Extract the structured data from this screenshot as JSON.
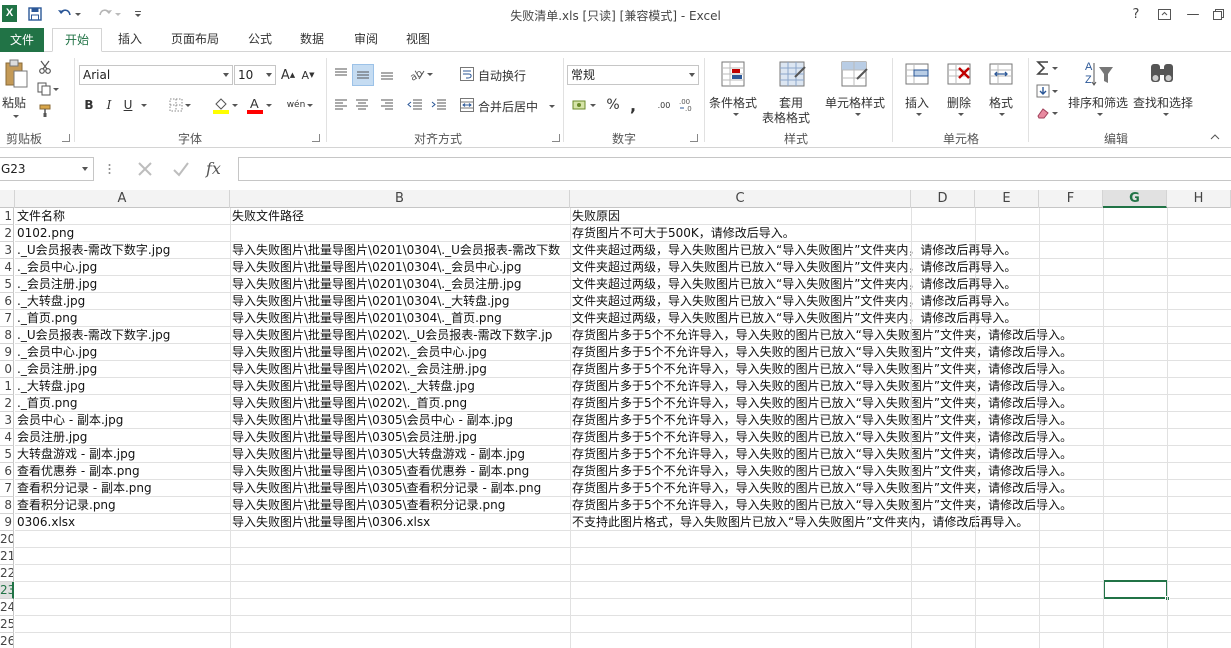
{
  "window": {
    "title": "失败清单.xls  [只读]  [兼容模式] - Excel",
    "help_label": "?",
    "min_label": "—",
    "accent": "#217346"
  },
  "ribbon_tabs": [
    "文件",
    "开始",
    "插入",
    "页面布局",
    "公式",
    "数据",
    "审阅",
    "视图"
  ],
  "ribbon": {
    "clipboard": {
      "paste": "粘贴",
      "label": "剪贴板"
    },
    "font": {
      "name": "Arial",
      "size": "10",
      "bold": "B",
      "italic": "I",
      "underline": "U",
      "pinyin": "wén",
      "label": "字体"
    },
    "alignment": {
      "wrap": "自动换行",
      "merge": "合并后居中",
      "label": "对齐方式"
    },
    "number": {
      "format": "常规",
      "percent": "%",
      "comma": ",",
      "inc_dec": ".00",
      "label": "数字"
    },
    "styles": {
      "cond": "条件格式",
      "table1": "套用",
      "table2": "表格格式",
      "cell": "单元格样式",
      "label": "样式"
    },
    "cells": {
      "insert": "插入",
      "delete": "删除",
      "format": "格式",
      "label": "单元格"
    },
    "editing": {
      "sort": "排序和筛选",
      "find": "查找和选择",
      "label": "编辑"
    }
  },
  "formula_bar": {
    "name_box": "G23",
    "value": ""
  },
  "columns": [
    "A",
    "B",
    "C",
    "D",
    "E",
    "F",
    "G",
    "H"
  ],
  "selected_column": "G",
  "selected_row": "23",
  "row_numbers": [
    "1",
    "2",
    "3",
    "4",
    "5",
    "6",
    "7",
    "8",
    "9",
    "0",
    "1",
    "2",
    "3",
    "4",
    "5",
    "6",
    "7",
    "8",
    "9",
    "20",
    "21",
    "22",
    "23",
    "24",
    "25",
    "26"
  ],
  "rows": [
    [
      "文件名称",
      "失败文件路径",
      "失败原因"
    ],
    [
      "0102.png",
      "",
      "存货图片不可大于500K，请修改后导入。"
    ],
    [
      "._U会员报表-需改下数字.jpg",
      "导入失败图片\\批量导图片\\0201\\0304\\._U会员报表-需改下数",
      "文件夹超过两级，导入失败图片已放入“导入失败图片”文件夹内，请修改后再导入。"
    ],
    [
      "._会员中心.jpg",
      "导入失败图片\\批量导图片\\0201\\0304\\._会员中心.jpg",
      "文件夹超过两级，导入失败图片已放入“导入失败图片”文件夹内，请修改后再导入。"
    ],
    [
      "._会员注册.jpg",
      "导入失败图片\\批量导图片\\0201\\0304\\._会员注册.jpg",
      "文件夹超过两级，导入失败图片已放入“导入失败图片”文件夹内，请修改后再导入。"
    ],
    [
      "._大转盘.jpg",
      "导入失败图片\\批量导图片\\0201\\0304\\._大转盘.jpg",
      "文件夹超过两级，导入失败图片已放入“导入失败图片”文件夹内，请修改后再导入。"
    ],
    [
      "._首页.png",
      "导入失败图片\\批量导图片\\0201\\0304\\._首页.png",
      "文件夹超过两级，导入失败图片已放入“导入失败图片”文件夹内，请修改后再导入。"
    ],
    [
      "._U会员报表-需改下数字.jpg",
      "导入失败图片\\批量导图片\\0202\\._U会员报表-需改下数字.jp",
      "存货图片多于5个不允许导入，导入失败的图片已放入“导入失败图片”文件夹，请修改后导入。"
    ],
    [
      "._会员中心.jpg",
      "导入失败图片\\批量导图片\\0202\\._会员中心.jpg",
      "存货图片多于5个不允许导入，导入失败的图片已放入“导入失败图片”文件夹，请修改后导入。"
    ],
    [
      "._会员注册.jpg",
      "导入失败图片\\批量导图片\\0202\\._会员注册.jpg",
      "存货图片多于5个不允许导入，导入失败的图片已放入“导入失败图片”文件夹，请修改后导入。"
    ],
    [
      "._大转盘.jpg",
      "导入失败图片\\批量导图片\\0202\\._大转盘.jpg",
      "存货图片多于5个不允许导入，导入失败的图片已放入“导入失败图片”文件夹，请修改后导入。"
    ],
    [
      "._首页.png",
      "导入失败图片\\批量导图片\\0202\\._首页.png",
      "存货图片多于5个不允许导入，导入失败的图片已放入“导入失败图片”文件夹，请修改后导入。"
    ],
    [
      "会员中心 - 副本.jpg",
      "导入失败图片\\批量导图片\\0305\\会员中心 - 副本.jpg",
      "存货图片多于5个不允许导入，导入失败的图片已放入“导入失败图片”文件夹，请修改后导入。"
    ],
    [
      "会员注册.jpg",
      "导入失败图片\\批量导图片\\0305\\会员注册.jpg",
      "存货图片多于5个不允许导入，导入失败的图片已放入“导入失败图片”文件夹，请修改后导入。"
    ],
    [
      "大转盘游戏 - 副本.jpg",
      "导入失败图片\\批量导图片\\0305\\大转盘游戏 - 副本.jpg",
      "存货图片多于5个不允许导入，导入失败的图片已放入“导入失败图片”文件夹，请修改后导入。"
    ],
    [
      "查看优惠券 - 副本.png",
      "导入失败图片\\批量导图片\\0305\\查看优惠券 - 副本.png",
      "存货图片多于5个不允许导入，导入失败的图片已放入“导入失败图片”文件夹，请修改后导入。"
    ],
    [
      "查看积分记录 - 副本.png",
      "导入失败图片\\批量导图片\\0305\\查看积分记录 - 副本.png",
      "存货图片多于5个不允许导入，导入失败的图片已放入“导入失败图片”文件夹，请修改后导入。"
    ],
    [
      "查看积分记录.png",
      "导入失败图片\\批量导图片\\0305\\查看积分记录.png",
      "存货图片多于5个不允许导入，导入失败的图片已放入“导入失败图片”文件夹，请修改后导入。"
    ],
    [
      "0306.xlsx",
      "导入失败图片\\批量导图片\\0306.xlsx",
      "不支持此图片格式，导入失败图片已放入“导入失败图片”文件夹内，请修改后再导入。"
    ]
  ]
}
